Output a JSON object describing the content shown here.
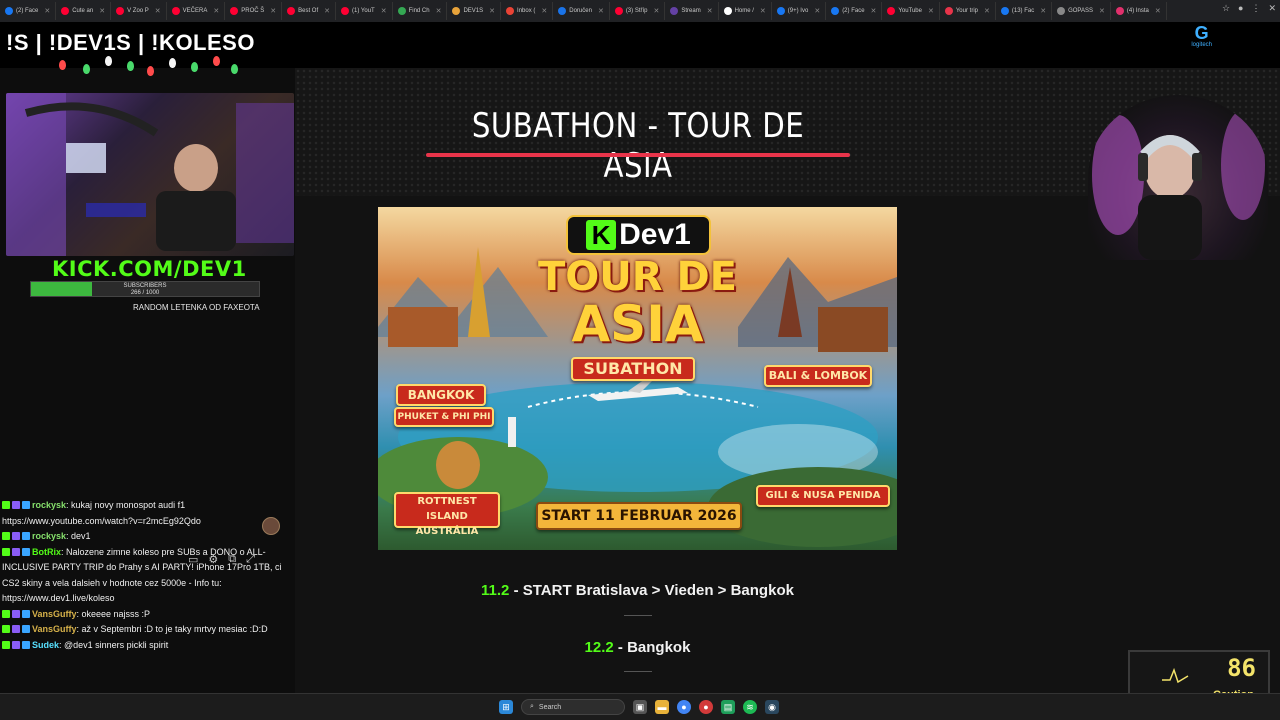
{
  "browser": {
    "tabs": [
      {
        "label": "(2) Face",
        "color": "#1877f2"
      },
      {
        "label": "Cute an",
        "color": "#ff0033"
      },
      {
        "label": "V Zoo P",
        "color": "#ff0033"
      },
      {
        "label": "VEČERA",
        "color": "#ff0033"
      },
      {
        "label": "PROČ Š",
        "color": "#ff0033"
      },
      {
        "label": "Best Of",
        "color": "#ff0033"
      },
      {
        "label": "(1) YouT",
        "color": "#ff0033"
      },
      {
        "label": "Find Ch",
        "color": "#34a853"
      },
      {
        "label": "DEV1S",
        "color": "#e8a33a"
      },
      {
        "label": "Inbox (",
        "color": "#ea4335"
      },
      {
        "label": "Doručen",
        "color": "#1a73e8"
      },
      {
        "label": "(3) Stříp",
        "color": "#ff0033"
      },
      {
        "label": "Stream",
        "color": "#6441a5"
      },
      {
        "label": "Home /",
        "color": "#ffffff"
      },
      {
        "label": "(9+) Ivo",
        "color": "#1877f2"
      },
      {
        "label": "(2) Face",
        "color": "#1877f2"
      },
      {
        "label": "YouTube",
        "color": "#ff0033"
      },
      {
        "label": "Your trip",
        "color": "#e8344a"
      },
      {
        "label": "(13) Fac",
        "color": "#1877f2"
      },
      {
        "label": "GOPASS",
        "color": "#888888"
      },
      {
        "label": "(4) Insta",
        "color": "#e1306c"
      }
    ],
    "logitech_label": "logitech"
  },
  "header": {
    "commands": "!S | !DEV1S | !KOLESO"
  },
  "stage": {
    "title": "SUBATHON - TOUR DE ASIA",
    "accent": "#e8344a"
  },
  "poster": {
    "brand": "Dev1",
    "brand_k": "K",
    "line1": "TOUR DE",
    "line2": "ASIA",
    "subathon": "SUBATHON",
    "bangkok": "BANGKOK",
    "phuket": "PHUKET & PHI PHI",
    "bali": "BALI & LOMBOK",
    "rottnest_1": "ROTTNEST ISLAND",
    "rottnest_2": "AUSTRÁLIA",
    "gili": "GILI & NUSA PENIDA",
    "start": "START 11 FEBRUAR 2026"
  },
  "schedule": [
    {
      "date": "11.2",
      "text": " - START Bratislava > Vieden > Bangkok"
    },
    {
      "date": "12.2",
      "text": " - Bangkok"
    }
  ],
  "sidebar": {
    "kick_url": "KICK.COM/DEV1",
    "subs_label": "SUBSCRIBERS",
    "subs_count": "266 / 1000",
    "subs_progress": 0.266,
    "random_text": "RANDOM LETENKA OD FAXEOTA"
  },
  "chat": {
    "messages": [
      {
        "user": "rockysk",
        "text": ": kukaj novy monospot audi f1 https://www.youtube.com/watch?v=r2mcEg92Qdo",
        "cls": "u-rock"
      },
      {
        "user": "rockysk",
        "text": ": dev1",
        "cls": "u-rock"
      },
      {
        "user": "BotRix",
        "text": ": Nalozene zimne koleso pre SUBs a DONO o ALL-INCLUSIVE PARTY TRIP do Prahy s AI PARTY! iPhone 17Pro 1TB, ci CS2 skiny a vela dalsieh v hodnote cez 5000e - Info tu: https://www.dev1.live/koleso",
        "cls": "u-bot"
      },
      {
        "user": "VansGuffy",
        "text": ": okeeee najsss :P",
        "cls": "u-van"
      },
      {
        "user": "VansGuffy",
        "text": ": až v Septembri :D to je taky mrtvy mesiac :D:D",
        "cls": "u-van"
      },
      {
        "user": "Sudek",
        "text": ": @dev1 sinners pickli spirit",
        "cls": "u-sud"
      }
    ]
  },
  "widget": {
    "value": "86",
    "status": "Caution"
  },
  "taskbar": {
    "search_label": "Search"
  }
}
